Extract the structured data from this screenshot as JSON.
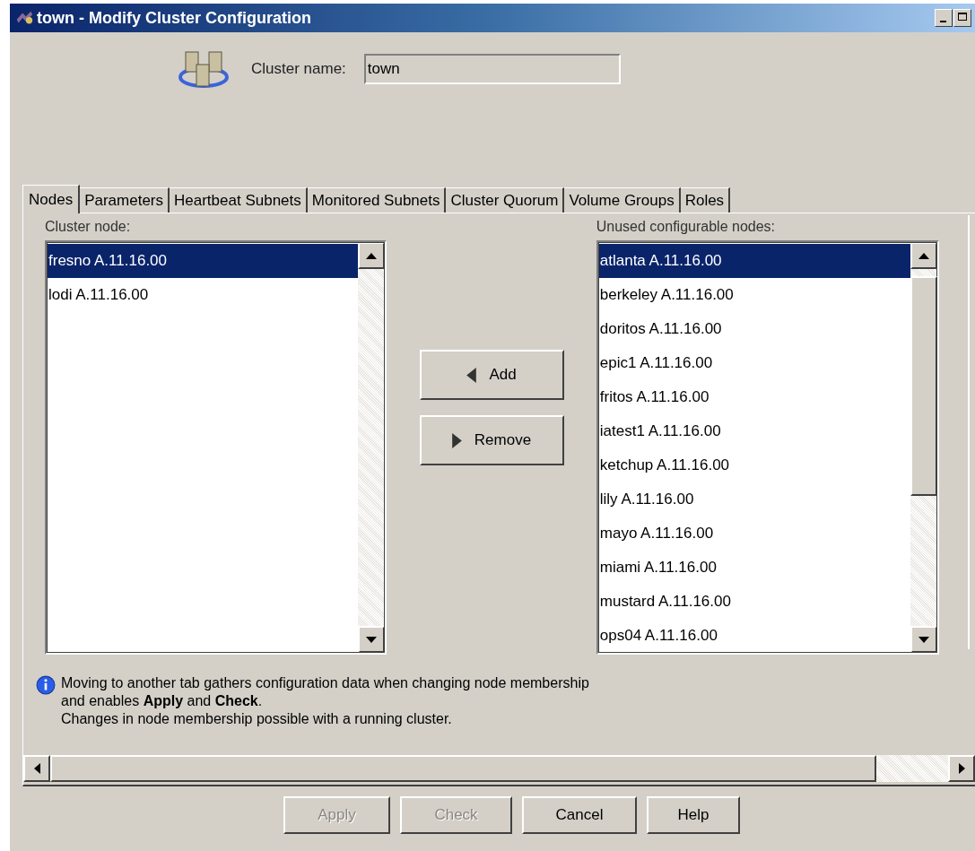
{
  "window": {
    "title": "town - Modify Cluster Configuration"
  },
  "cluster_name": {
    "label": "Cluster name:",
    "value": "town"
  },
  "tabs": [
    {
      "label": "Nodes",
      "selected": true
    },
    {
      "label": "Parameters",
      "selected": false
    },
    {
      "label": "Heartbeat Subnets",
      "selected": false
    },
    {
      "label": "Monitored Subnets",
      "selected": false
    },
    {
      "label": "Cluster Quorum",
      "selected": false
    },
    {
      "label": "Volume Groups",
      "selected": false
    },
    {
      "label": "Roles",
      "selected": false
    }
  ],
  "cluster_nodes": {
    "label": "Cluster node:",
    "items": [
      {
        "text": "fresno A.11.16.00",
        "selected": true
      },
      {
        "text": "lodi A.11.16.00",
        "selected": false
      }
    ]
  },
  "move_buttons": [
    {
      "label": "Add",
      "kind": "left"
    },
    {
      "label": "Remove",
      "kind": "right"
    }
  ],
  "unused_nodes": {
    "label": "Unused configurable nodes:",
    "items": [
      {
        "text": "atlanta A.11.16.00",
        "selected": true
      },
      {
        "text": "berkeley A.11.16.00",
        "selected": false
      },
      {
        "text": "doritos A.11.16.00",
        "selected": false
      },
      {
        "text": "epic1 A.11.16.00",
        "selected": false
      },
      {
        "text": "fritos A.11.16.00",
        "selected": false
      },
      {
        "text": "iatest1 A.11.16.00",
        "selected": false
      },
      {
        "text": "ketchup A.11.16.00",
        "selected": false
      },
      {
        "text": "lily A.11.16.00",
        "selected": false
      },
      {
        "text": "mayo A.11.16.00",
        "selected": false
      },
      {
        "text": "miami A.11.16.00",
        "selected": false
      },
      {
        "text": "mustard A.11.16.00",
        "selected": false
      },
      {
        "text": "ops04 A.11.16.00",
        "selected": false
      }
    ]
  },
  "info": [
    "Moving to another tab gathers configuration data when changing node membership",
    "and enables **Apply** and **Check**.",
    "Changes in node membership possible with a running cluster."
  ],
  "buttons": [
    {
      "label": "Apply",
      "disabled": true
    },
    {
      "label": "Check",
      "disabled": true
    },
    {
      "label": "Cancel",
      "disabled": false
    },
    {
      "label": "Help",
      "disabled": false
    }
  ]
}
